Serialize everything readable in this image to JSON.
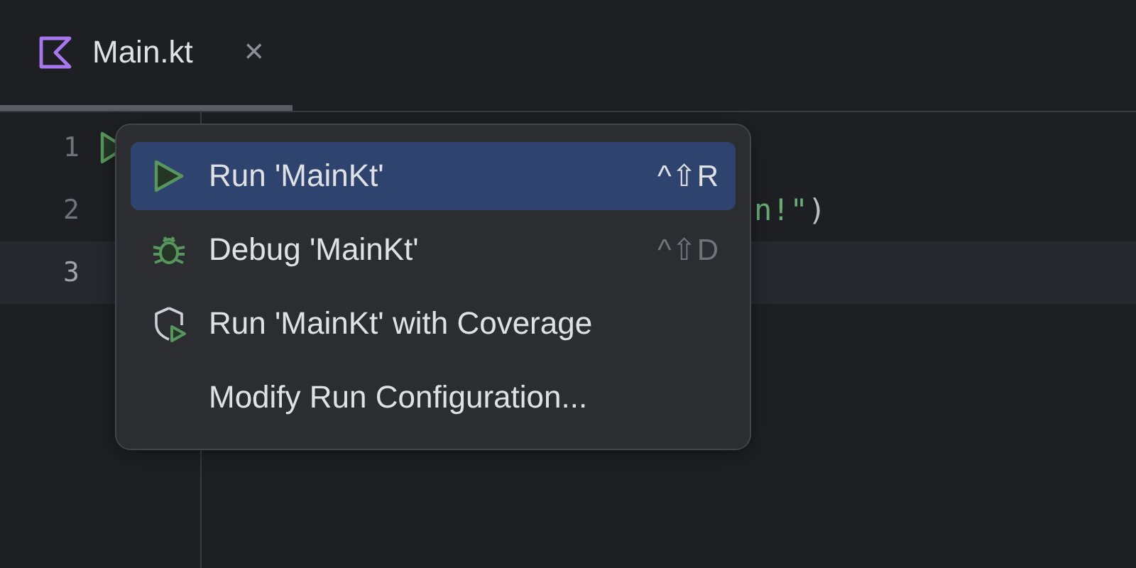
{
  "tabs": [
    {
      "label": "Main.kt",
      "selected": true,
      "close": "×"
    }
  ],
  "editor": {
    "lines": [
      {
        "number": "1",
        "current": false,
        "run_marker": true
      },
      {
        "number": "2",
        "current": false,
        "run_marker": false,
        "code": [
          {
            "text": "n!\"",
            "kind": "string"
          },
          {
            "text": ")",
            "kind": "punct"
          }
        ]
      },
      {
        "number": "3",
        "current": true,
        "run_marker": false
      }
    ]
  },
  "popup_menu": {
    "items": [
      {
        "label": "Run 'MainKt'",
        "kind": "run",
        "shortcut": "^⇧R",
        "selected": true
      },
      {
        "label": "Debug 'MainKt'",
        "kind": "debug",
        "shortcut": "^⇧D",
        "selected": false
      },
      {
        "label": "Run 'MainKt' with Coverage",
        "kind": "coverage",
        "selected": false
      },
      {
        "label": "Modify Run Configuration...",
        "kind": "configure",
        "selected": false
      }
    ]
  }
}
